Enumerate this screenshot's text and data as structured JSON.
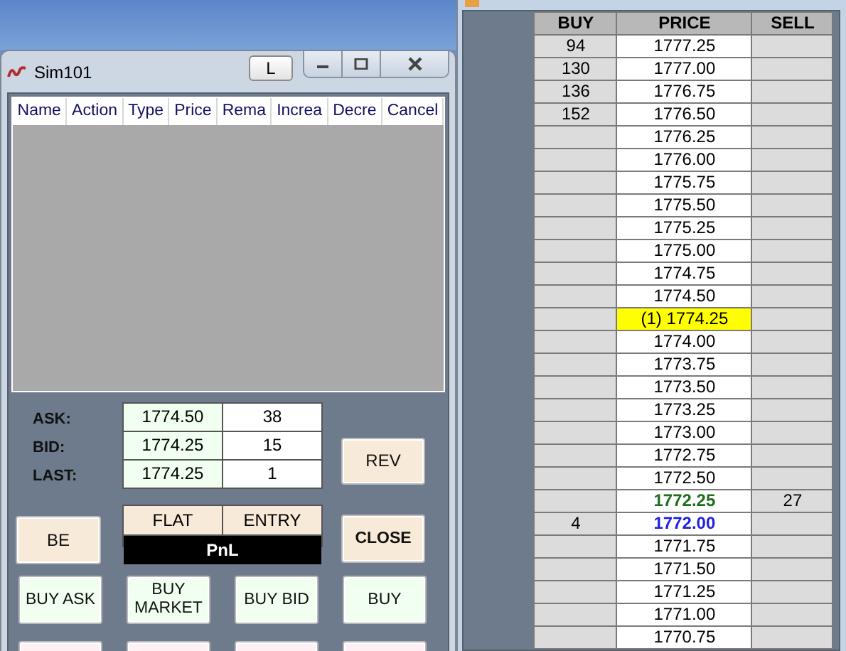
{
  "window": {
    "title": "Sim101",
    "lock_button": "L"
  },
  "orders": {
    "columns": [
      "Name",
      "Action",
      "Type",
      "Price",
      "Rema",
      "Increa",
      "Decre",
      "Cancel"
    ]
  },
  "quotes": [
    {
      "label": "ASK:",
      "price": "1774.50",
      "size": "38"
    },
    {
      "label": "BID:",
      "price": "1774.25",
      "size": "15"
    },
    {
      "label": "LAST:",
      "price": "1774.25",
      "size": "1"
    }
  ],
  "position": {
    "status": "FLAT",
    "entry": "ENTRY",
    "pnl": "PnL"
  },
  "side_buttons": {
    "rev": "REV",
    "be": "BE",
    "close": "CLOSE"
  },
  "buy_buttons": [
    "BUY ASK",
    "BUY\nMARKET",
    "BUY BID",
    "BUY"
  ],
  "ladder": {
    "columns": [
      "BUY",
      "PRICE",
      "SELL"
    ],
    "rows": [
      {
        "buy": "94",
        "price": "1777.25",
        "sell": "",
        "kind": "plain"
      },
      {
        "buy": "130",
        "price": "1777.00",
        "sell": "",
        "kind": "plain"
      },
      {
        "buy": "136",
        "price": "1776.75",
        "sell": "",
        "kind": "plain"
      },
      {
        "buy": "152",
        "price": "1776.50",
        "sell": "",
        "kind": "plain"
      },
      {
        "buy": "",
        "price": "1776.25",
        "sell": "",
        "kind": "plain"
      },
      {
        "buy": "",
        "price": "1776.00",
        "sell": "",
        "kind": "plain"
      },
      {
        "buy": "",
        "price": "1775.75",
        "sell": "",
        "kind": "plain"
      },
      {
        "buy": "",
        "price": "1775.50",
        "sell": "",
        "kind": "plain"
      },
      {
        "buy": "",
        "price": "1775.25",
        "sell": "",
        "kind": "plain"
      },
      {
        "buy": "",
        "price": "1775.00",
        "sell": "",
        "kind": "plain"
      },
      {
        "buy": "",
        "price": "1774.75",
        "sell": "",
        "kind": "plain"
      },
      {
        "buy": "",
        "price": "1774.50",
        "sell": "",
        "kind": "plain"
      },
      {
        "buy": "",
        "price": "(1) 1774.25",
        "sell": "",
        "kind": "position"
      },
      {
        "buy": "",
        "price": "1774.00",
        "sell": "",
        "kind": "plain"
      },
      {
        "buy": "",
        "price": "1773.75",
        "sell": "",
        "kind": "plain"
      },
      {
        "buy": "",
        "price": "1773.50",
        "sell": "",
        "kind": "plain"
      },
      {
        "buy": "",
        "price": "1773.25",
        "sell": "",
        "kind": "plain"
      },
      {
        "buy": "",
        "price": "1773.00",
        "sell": "",
        "kind": "plain"
      },
      {
        "buy": "",
        "price": "1772.75",
        "sell": "",
        "kind": "plain"
      },
      {
        "buy": "",
        "price": "1772.50",
        "sell": "",
        "kind": "plain"
      },
      {
        "buy": "",
        "price": "1772.25",
        "sell": "27",
        "kind": "ask"
      },
      {
        "buy": "4",
        "price": "1772.00",
        "sell": "",
        "kind": "bid"
      },
      {
        "buy": "",
        "price": "1771.75",
        "sell": "",
        "kind": "plain"
      },
      {
        "buy": "",
        "price": "1771.50",
        "sell": "",
        "kind": "plain"
      },
      {
        "buy": "",
        "price": "1771.25",
        "sell": "",
        "kind": "plain"
      },
      {
        "buy": "",
        "price": "1771.00",
        "sell": "",
        "kind": "plain"
      },
      {
        "buy": "",
        "price": "1770.75",
        "sell": "",
        "kind": "plain"
      }
    ]
  }
}
